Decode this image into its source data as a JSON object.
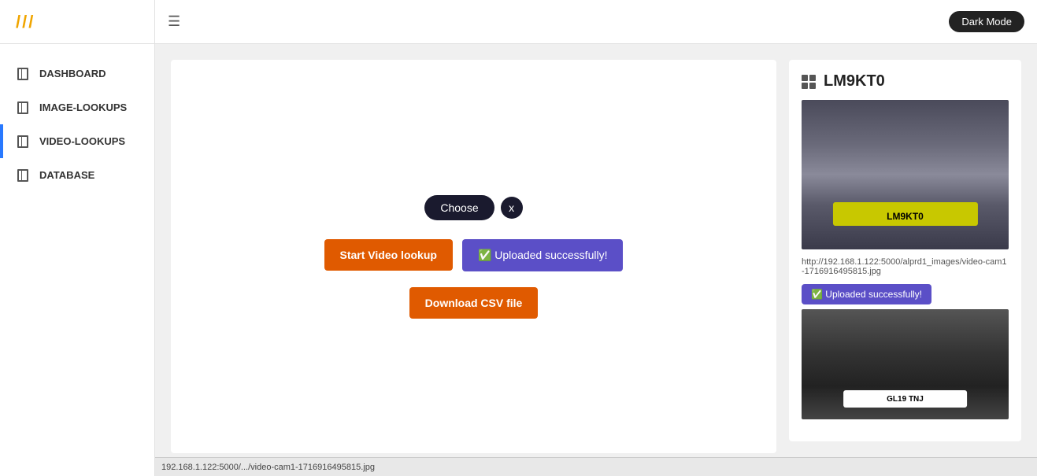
{
  "app": {
    "logo": "///",
    "dark_mode_label": "Dark Mode"
  },
  "sidebar": {
    "items": [
      {
        "id": "dashboard",
        "label": "DASHBOARD",
        "active": false
      },
      {
        "id": "image-lookups",
        "label": "IMAGE-LOOKUPS",
        "active": false
      },
      {
        "id": "video-lookups",
        "label": "VIDEO-LOOKUPS",
        "active": true
      },
      {
        "id": "database",
        "label": "DATABASE",
        "active": false
      }
    ]
  },
  "topbar": {
    "hamburger_icon": "☰"
  },
  "upload_section": {
    "choose_label": "Choose",
    "clear_label": "x",
    "start_lookup_label": "Start Video lookup",
    "upload_success_label": "✅ Uploaded successfully!",
    "download_csv_label": "Download CSV file"
  },
  "results": {
    "plate": "LM9KT0",
    "image_url": "http://192.168.1.122:5000/alprd1_images/video-cam1-1716916495815.jpg",
    "upload_badge": "✅ Uploaded successfully!",
    "second_upload_badge": "✅ Uploaded successfully!"
  },
  "statusbar": {
    "text": "192.168.1.122:5000/.../video-cam1-1716916495815.jpg"
  }
}
